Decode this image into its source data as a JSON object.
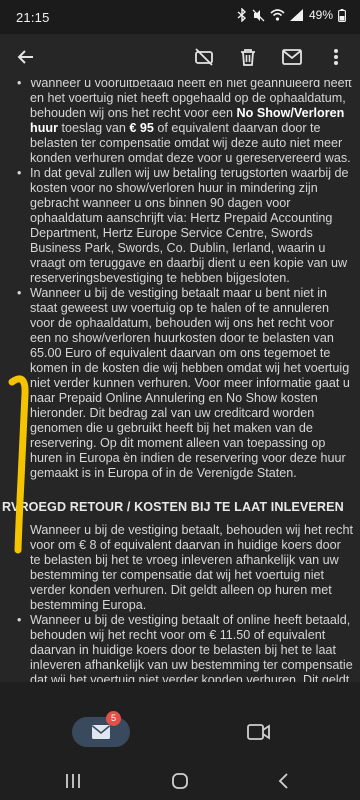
{
  "status_bar": {
    "time": "21:15",
    "battery": "49%"
  },
  "icons": {
    "back": "arrow-left-icon",
    "no_attachments": "attachment-off-icon",
    "delete": "trash-icon",
    "mail": "mail-icon"
  },
  "body": {
    "bullet_1": {
      "pre": "Wanneer u vooruitbetaald heeft en niet geannuleerd heeft en het voertuig niet heeft opgehaald op de ophaaldatum, behouden wij ons het recht voor een ",
      "bold": "No Show/Verloren huur",
      "mid": " toeslag van ",
      "amount": "€ 95",
      "post": " of equivalent daarvan door te belasten ter compensatie omdat wij deze auto niet meer konden verhuren omdat deze voor u gereservereerd was."
    },
    "bullet_2": "In dat geval zullen wij uw betaling terugstorten waarbij de kosten voor no show/verloren huur in mindering zijn gebracht wanneer u ons binnen 90 dagen voor ophaaldatum aanschrijft via: Hertz Prepaid Accounting Department, Hertz Europe Service Centre, Swords Business Park, Swords, Co. Dublin, Ierland, waarin u vraagt om teruggave en daarbij dient u een kopie van uw reserveringsbevestiging te hebben bijgesloten.",
    "bullet_3": "Wanneer u bij de vestiging betaalt maar u bent niet in staat geweest uw voertuig op te halen of te annuleren voor de ophaaldatum, behouden wij ons het recht voor een no show/verloren huurkosten door te belasten van 65.00 Euro of equivalent daarvan om ons tegemoet te komen in de kosten die wij hebben omdat wij het voertuig niet verder kunnen verhuren. Voor meer informatie gaat u naar Prepaid Online Annulering en No Show kosten hieronder. Dit bedrag zal van uw creditcard worden genomen die u gebruikt heeft bij het maken van de reservering. Op dit moment alleen van toepassing op huren in Europa èn indien de reservering voor deze huur gemaakt is in Europa of in de Verenigde Staten.",
    "section_heading": "RVROEGD RETOUR / KOSTEN BIJ TE LAAT INLEVEREN",
    "bullet_4": "Wanneer u bij de vestiging betaalt, behouden wij het recht voor om € 8 of equivalent daarvan in huidige koers door te belasten bij het te vroeg inleveren afhankelijk van uw bestemming ter compensatie dat wij het voertuig niet verder konden verhuren. Dit geldt alleen op huren met bestemming Europa.",
    "bullet_5": "Wanneer u bij de vestiging betaalt of online heeft betaald, behouden wij het recht voor om € 11.50 of equivalent daarvan in huidige koers door te belasten bij het te laat inleveren afhankelijk van uw bestemming ter compensatie dat wij het voertuig niet verder konden verhuren. Dit geldt alleen op huren met bestemming Europa."
  },
  "bottom_nav": {
    "mail_badge": "5"
  },
  "colors": {
    "accent": "#3a4a5e",
    "badge": "#e2504a",
    "highlight": "#f5c400"
  }
}
